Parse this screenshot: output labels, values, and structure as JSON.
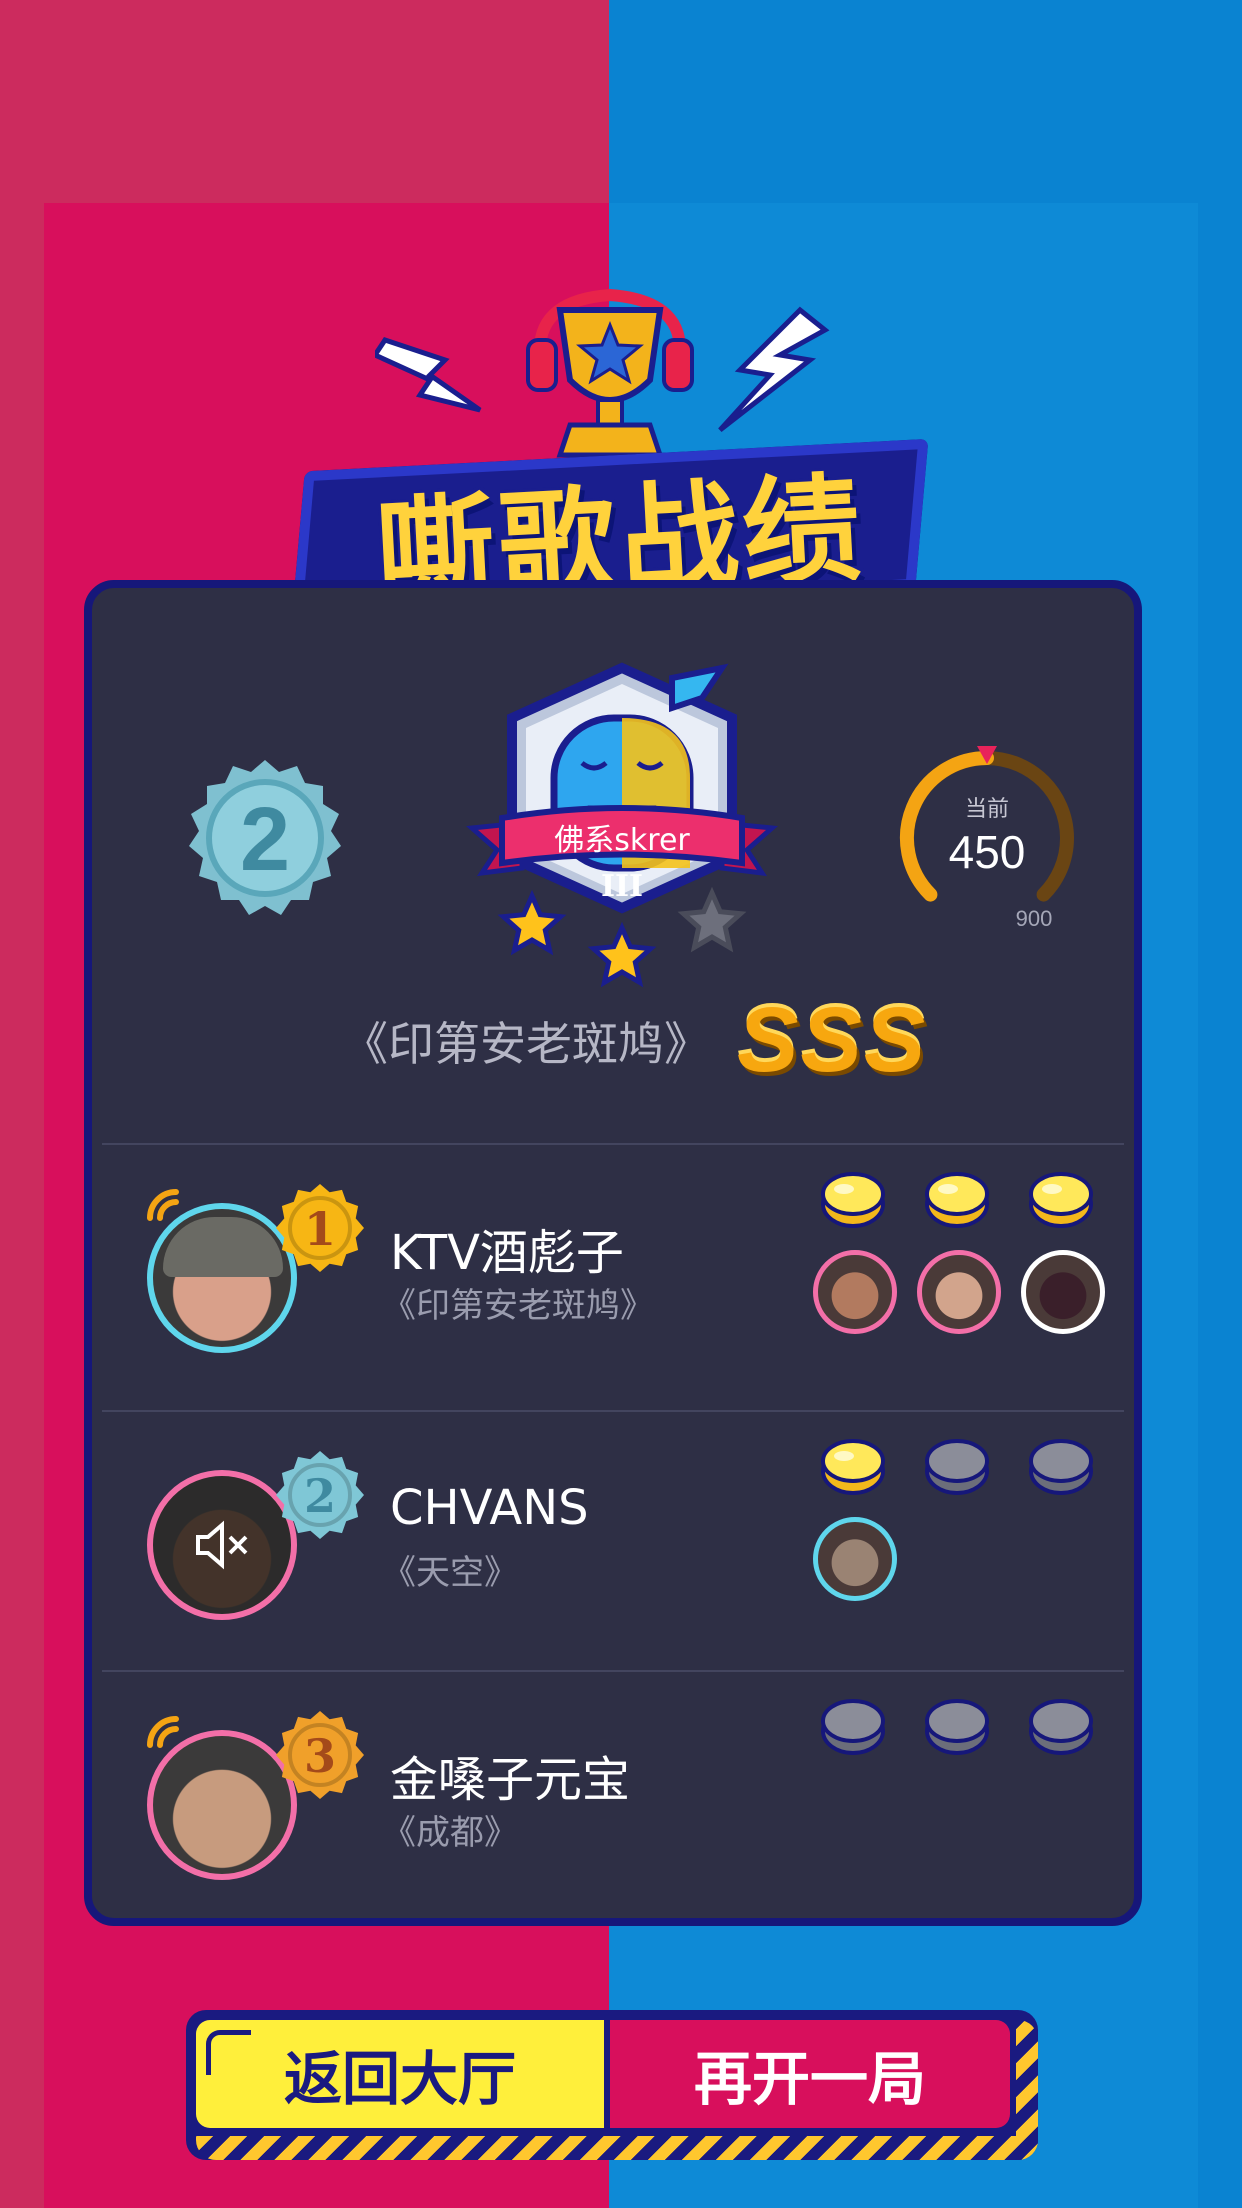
{
  "header": {
    "title": "嘶歌战绩"
  },
  "result": {
    "rank_number": "2",
    "level_name": "佛系skrer",
    "level_tier": "III",
    "stars_earned": 2,
    "stars_total": 3,
    "gauge_label": "当前",
    "gauge_value": "450",
    "gauge_max": "900",
    "gauge_fraction": 0.5,
    "song_title": "《印第安老斑鸠》",
    "grade": "SSS"
  },
  "players": [
    {
      "name": "KTV酒彪子",
      "song": "《印第安老斑鸠》",
      "rank": "1",
      "speaking": true,
      "muted": false,
      "coins_filled": 3,
      "voters": 3
    },
    {
      "name": "CHVANS",
      "song": "《天空》",
      "rank": "2",
      "speaking": false,
      "muted": true,
      "coins_filled": 1,
      "voters": 1
    },
    {
      "name": "金嗓子元宝",
      "song": "《成都》",
      "rank": "3",
      "speaking": true,
      "muted": false,
      "coins_filled": 0,
      "voters": 0
    }
  ],
  "buttons": {
    "back_lobby": "返回大厅",
    "play_again": "再开一局"
  },
  "colors": {
    "bg_left": "#d80f5c",
    "bg_right": "#0e8ad6",
    "card": "#2e2f45",
    "gold": "#f7a70f",
    "yellow_button": "#ffef3b"
  }
}
